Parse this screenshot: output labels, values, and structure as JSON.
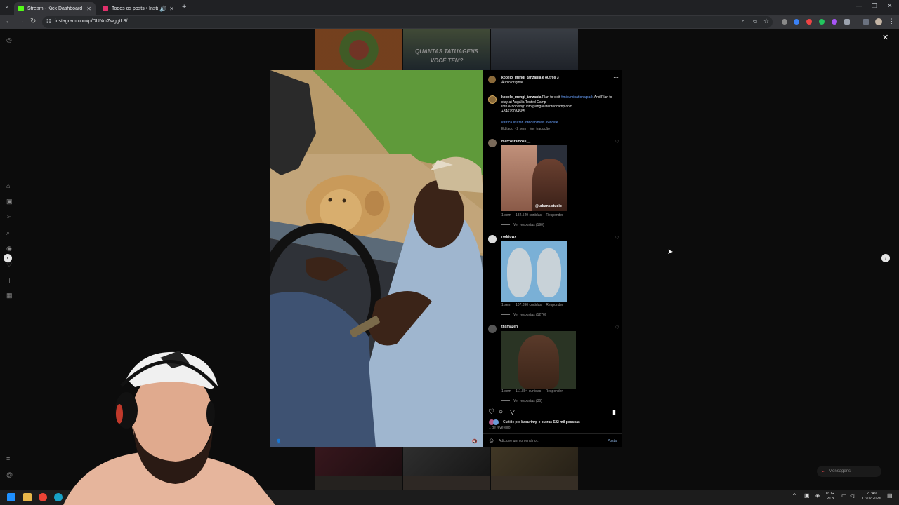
{
  "browser": {
    "tabs": [
      {
        "label": "Stream - Kick Dashboard",
        "color": "#53fc18"
      },
      {
        "label": "Todos os posts • Instagram",
        "color": "#e1306c"
      }
    ],
    "url": "instagram.com/p/DUNmZwggtL8/"
  },
  "background_posts": {
    "caption_overlay": "QUANTAS TATUAGENS VOCÊ TEM?"
  },
  "post": {
    "header": {
      "author": "kobelo_mengi_tanzania e outros 3",
      "audio": "Áudio original",
      "more_icon": "ellipsis-icon"
    },
    "caption": {
      "author": "kobelo_mengi_tanzania",
      "text_1": " Plan to visit ",
      "tag_park": "#mikuminationalpark",
      "text_2": " And Plan to stay at Angalia Tented Camp",
      "text_3": "Info & booking: info@angaliatentedcamp.com",
      "text_4": "+34679034585",
      "hashtags": "#africa #safari #wildanimals #wildlife",
      "meta_time": "Editado · 2 sem",
      "meta_translate": "Ver tradução"
    },
    "comments": [
      {
        "user": "marcosramoss__",
        "time": "1 sem",
        "likes": "182.549 curtidas",
        "reply": "Responder",
        "view": "Ver respostas (190)",
        "sticker": "@urbans.studio"
      },
      {
        "user": "rodrigwx_",
        "time": "1 sem",
        "likes": "107.890 curtidas",
        "reply": "Responder",
        "view": "Ver respostas (1276)"
      },
      {
        "user": "thsmazen",
        "time": "1 sem",
        "likes": "111.894 curtidas",
        "reply": "Responder",
        "view": "Ver respostas (36)"
      }
    ],
    "liked_by_prefix": "Curtido por ",
    "liked_by_user": "bacurinrp",
    "liked_by_suffix": " e outras 622 mil pessoas",
    "date": "1 de fevereiro",
    "comment_placeholder": "Adicione um comentário...",
    "post_button": "Postar"
  },
  "messages_pill": "Mensagens",
  "taskbar": {
    "lang_1": "POR",
    "lang_2": "PTB",
    "time": "21:49",
    "date": "17/02/2026"
  },
  "colors": {
    "instagram_link": "#6aa2ff",
    "kick_green": "#53fc18",
    "instagram_pink": "#e1306c"
  }
}
